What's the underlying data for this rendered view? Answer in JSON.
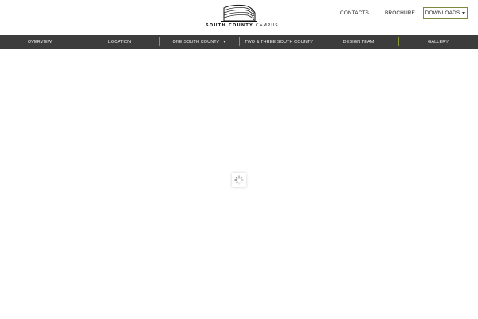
{
  "logo": {
    "text_bold": "SOUTH COUNTY",
    "text_light": "CAMPUS"
  },
  "top_links": {
    "contacts": "CONTACTS",
    "brochure": "BROCHURE",
    "downloads": "DOWNLOADS"
  },
  "nav": {
    "items": [
      {
        "label": "OVERVIEW"
      },
      {
        "label": "LOCATION"
      },
      {
        "label": "ONE SOUTH COUNTY"
      },
      {
        "label": "TWO & THREE SOUTH COUNTY"
      },
      {
        "label": "DESIGN TEAM"
      },
      {
        "label": "GALLERY"
      }
    ]
  },
  "icons": {
    "logo": "building-logo-icon",
    "dropdown": "caret-down-icon",
    "loading": "spinner-icon"
  },
  "colors": {
    "nav_background": "#3c3c3c",
    "nav_divider": "#8c9a3a",
    "downloads_border": "#7a8a3e"
  }
}
